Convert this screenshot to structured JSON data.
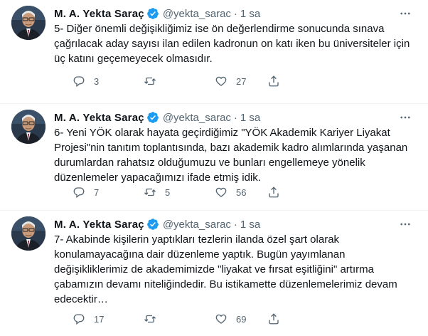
{
  "tweets": [
    {
      "author": "M. A. Yekta Saraç",
      "handle": "@yekta_sarac",
      "separator": "·",
      "time": "1 sa",
      "text": "5- Diğer önemli değişikliğimiz ise ön değerlendirme sonucunda sınava çağrılacak aday sayısı ilan edilen kadronun on katı iken bu üniversiteler için üç katını geçemeyecek olmasıdır.",
      "replies": "3",
      "retweets": "",
      "likes": "27"
    },
    {
      "author": "M. A. Yekta Saraç",
      "handle": "@yekta_sarac",
      "separator": "·",
      "time": "1 sa",
      "text": "6- Yeni YÖK olarak hayata geçirdiğimiz \"YÖK Akademik Kariyer Liyakat Projesi\"nin tanıtım toplantısında, bazı akademik kadro alımlarında yaşanan durumlardan rahatsız olduğumuzu ve bunları engellemeye yönelik düzenlemeler yapacağımızı ifade etmiş idik.",
      "replies": "7",
      "retweets": "5",
      "likes": "56"
    },
    {
      "author": "M. A. Yekta Saraç",
      "handle": "@yekta_sarac",
      "separator": "·",
      "time": "1 sa",
      "text": "7- Akabinde kişilerin yaptıkları tezlerin ilanda özel şart olarak konulamayacağına dair düzenleme yaptık. Bugün yayımlanan değişikliklerimiz de akademimizde \"liyakat ve fırsat eşitliğini\" artırma çabamızın devamı niteliğindedir. Bu istikamette düzenlemelerimiz devam edecektir…",
      "replies": "17",
      "retweets": "",
      "likes": "69"
    }
  ],
  "colors": {
    "text": "#0f1419",
    "secondary": "#536471",
    "verified": "#1d9bf0",
    "border": "#eff3f4"
  },
  "icons": [
    "verified-badge-icon",
    "more-icon",
    "reply-icon",
    "retweet-icon",
    "like-icon",
    "share-icon"
  ]
}
